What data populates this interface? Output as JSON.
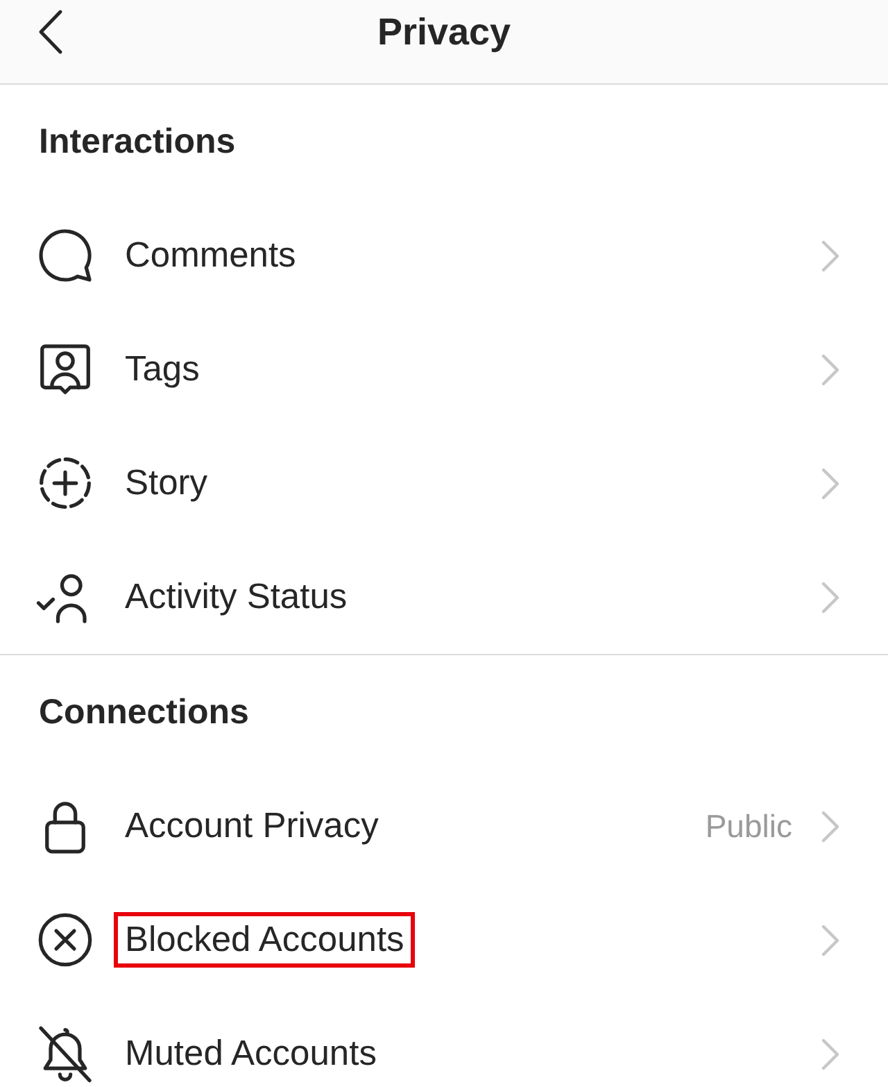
{
  "header": {
    "title": "Privacy"
  },
  "sections": [
    {
      "heading": "Interactions",
      "items": [
        {
          "label": "Comments",
          "highlighted": false
        },
        {
          "label": "Tags",
          "highlighted": false
        },
        {
          "label": "Story",
          "highlighted": false
        },
        {
          "label": "Activity Status",
          "highlighted": false
        }
      ]
    },
    {
      "heading": "Connections",
      "items": [
        {
          "label": "Account Privacy",
          "value": "Public",
          "highlighted": false
        },
        {
          "label": "Blocked Accounts",
          "highlighted": true
        },
        {
          "label": "Muted Accounts",
          "highlighted": false
        }
      ]
    }
  ]
}
